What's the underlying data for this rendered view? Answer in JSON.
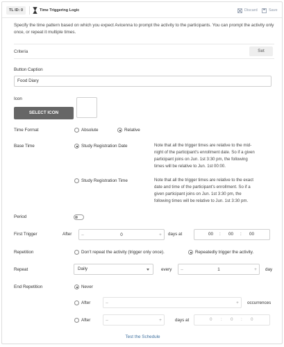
{
  "header": {
    "tl_id": "TL ID: 0",
    "tab_title": "Time Triggering Logic",
    "discard_label": "Discard",
    "save_label": "Save"
  },
  "description": "Specify the time pattern based on which you expect Avicenna to prompt the activity to the participants. You can prompt the activity only once, or repeat it multiple times.",
  "criteria": {
    "label": "Criteria",
    "set_label": "Set"
  },
  "button_caption": {
    "label": "Button Caption",
    "value": "Food Diary"
  },
  "icon": {
    "label": "Icon",
    "select_label": "SELECT ICON"
  },
  "time_format": {
    "label": "Time Format",
    "options": [
      "Absolute",
      "Relative"
    ],
    "selected": "Relative"
  },
  "base_time": {
    "label": "Base Time",
    "options": [
      {
        "label": "Study Registration Date",
        "note": "Note that all the trigger times are relative to the mid-night of the participant's enrollment date. So if a given participant joins on Jun. 1st 3:30 pm, the following times will be relative to Jun. 1st 00:00.",
        "selected": true
      },
      {
        "label": "Study Registration Time",
        "note": "Note that all the trigger times are relative to the exact date and time of the participant's enrollment. So if a given participant joins on Jun. 1st 3:30 pm, the following times will be relative to Jun. 1st 3:30 pm.",
        "selected": false
      }
    ]
  },
  "period": {
    "label": "Period",
    "enabled": false
  },
  "first_trigger": {
    "label": "First Trigger",
    "after_label": "After",
    "days_value": "0",
    "days_at_label": "days at",
    "hours": "00",
    "minutes": "00",
    "seconds": "00"
  },
  "repetition": {
    "label": "Repetition",
    "options": [
      "Don't repeat the activity (trigger only once).",
      "Repeatedly trigger the activity."
    ],
    "selected": "Repeatedly trigger the activity."
  },
  "repeat": {
    "label": "Repeat",
    "frequency": "Daily",
    "every_label": "every",
    "every_value": "1",
    "unit_label": "day"
  },
  "end_repetition": {
    "label": "End Repetition",
    "never_label": "Never",
    "after_label": "After",
    "occurrences_label": "occurrences",
    "after2_label": "After",
    "days_at_label": "days at",
    "time_hours": "0",
    "time_minutes": "0",
    "time_seconds": "0",
    "selected": "Never"
  },
  "test_schedule_label": "Test the Schedule"
}
